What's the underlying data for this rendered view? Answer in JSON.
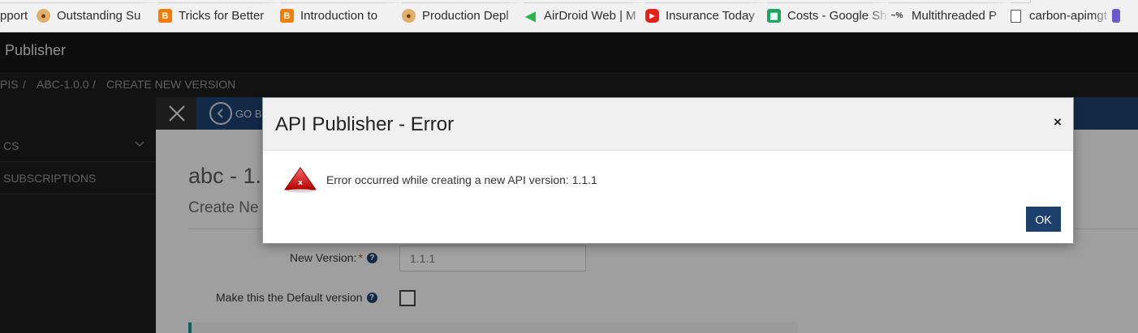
{
  "bookmarks": [
    {
      "label": "pport",
      "icon": "none"
    },
    {
      "label": "Outstanding Su",
      "icon": "bug-icon"
    },
    {
      "label": "Tricks for Better",
      "icon": "blogger-icon"
    },
    {
      "label": "Introduction to",
      "icon": "blogger-icon"
    },
    {
      "label": "Production Depl",
      "icon": "bug-icon"
    },
    {
      "label": "AirDroid Web | M",
      "icon": "airdroid-icon"
    },
    {
      "label": "Insurance Today",
      "icon": "youtube-icon"
    },
    {
      "label": "Costs - Google Sh",
      "icon": "sheets-icon"
    },
    {
      "label": "Multithreaded P",
      "icon": "tilde-percent-icon"
    },
    {
      "label": "carbon-apimgt [",
      "icon": "page-icon"
    }
  ],
  "app": {
    "title": "Publisher"
  },
  "breadcrumb": {
    "items": [
      "PIS",
      "ABC-1.0.0",
      "CREATE NEW VERSION"
    ],
    "separator": "/"
  },
  "sidebar": {
    "items": [
      {
        "label": "CS"
      },
      {
        "label": "SUBSCRIPTIONS"
      }
    ]
  },
  "toolbar": {
    "go_back_label": "GO B"
  },
  "page": {
    "title": "abc - 1.",
    "subtitle": "Create Ne"
  },
  "form": {
    "new_version_label": "New Version:",
    "required_mark": "*",
    "new_version_value": "1.1.1",
    "default_version_label": "Make this the Default version",
    "help_glyph": "?"
  },
  "modal": {
    "title": "API Publisher - Error",
    "close_glyph": "×",
    "error_icon_glyph": "x",
    "message": "Error occurred while creating a new API version: 1.1.1",
    "ok_label": "OK"
  },
  "colors": {
    "accent": "#1d3f6b",
    "error": "#d62828",
    "teal": "#1a8a8a"
  }
}
